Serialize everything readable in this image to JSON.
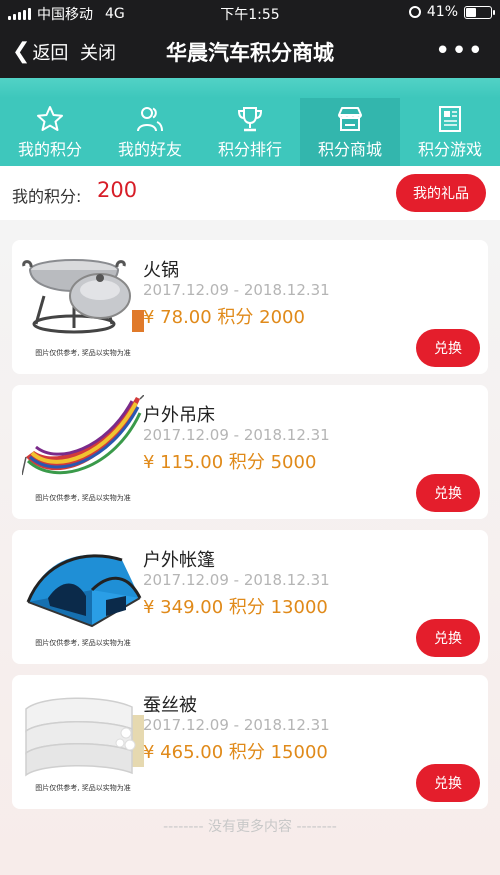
{
  "status_bar": {
    "carrier": "中国移动",
    "network": "4G",
    "time": "下午1:55",
    "battery": "41%",
    "battery_level": 0.41
  },
  "nav": {
    "back_label": "返回",
    "close_label": "关闭",
    "title": "华晨汽车积分商城",
    "more": "•••"
  },
  "tabs": [
    {
      "label": "我的积分",
      "icon": "star-icon"
    },
    {
      "label": "我的好友",
      "icon": "friends-icon"
    },
    {
      "label": "积分排行",
      "icon": "trophy-icon"
    },
    {
      "label": "积分商城",
      "icon": "store-icon",
      "active": true
    },
    {
      "label": "积分游戏",
      "icon": "game-icon"
    }
  ],
  "points": {
    "label": "我的积分:",
    "value": "200",
    "gift_button": "我的礼品"
  },
  "products": [
    {
      "name": "火锅",
      "date_range": "2017.12.09 - 2018.12.31",
      "price": "¥ 78.00 积分 2000",
      "disclaimer": "图片仅供参考, 奖品以实物为准",
      "button": "兑换",
      "icon": "hotpot-icon"
    },
    {
      "name": "户外吊床",
      "date_range": "2017.12.09 - 2018.12.31",
      "price": "¥ 115.00 积分 5000",
      "disclaimer": "图片仅供参考, 奖品以实物为准",
      "button": "兑换",
      "icon": "hammock-icon"
    },
    {
      "name": "户外帐篷",
      "date_range": "2017.12.09 - 2018.12.31",
      "price": "¥ 349.00 积分 13000",
      "disclaimer": "图片仅供参考, 奖品以实物为准",
      "button": "兑换",
      "icon": "tent-icon"
    },
    {
      "name": "蚕丝被",
      "date_range": "2017.12.09 - 2018.12.31",
      "price": "¥ 465.00 积分 15000",
      "disclaimer": "图片仅供参考, 奖品以实物为准",
      "button": "兑换",
      "icon": "quilt-icon"
    }
  ],
  "end_note": "-------- 没有更多内容 --------",
  "colors": {
    "nav_bg": "#1c1c1e",
    "tab_bg": "#3ec7bc",
    "accent_red": "#e41e2c",
    "points_red": "#d71d27",
    "price_orange": "#e08a1a"
  }
}
